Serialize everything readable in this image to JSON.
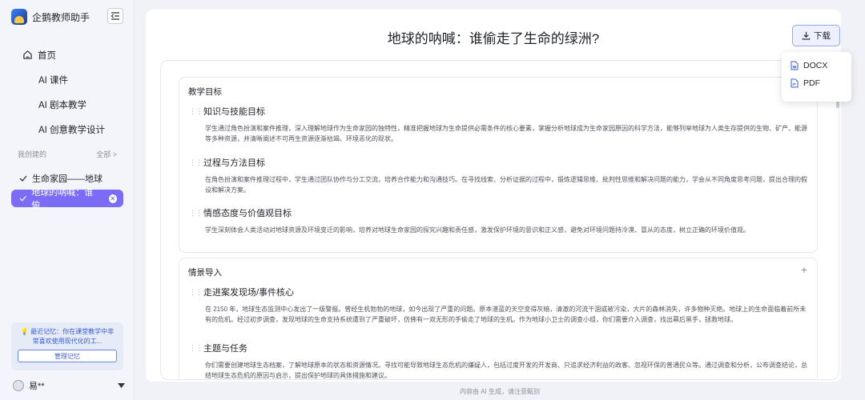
{
  "sidebar": {
    "brand": "企鹅教师助手",
    "nav": [
      {
        "label": "首页"
      },
      {
        "label": "AI 课件"
      },
      {
        "label": "AI 剧本教学"
      },
      {
        "label": "AI 创意教学设计"
      }
    ],
    "section_label": "我创建的",
    "section_all": "全部 >",
    "history": [
      {
        "label": "生命家园——地球"
      },
      {
        "label": "地球的呐喊：谁偷..."
      }
    ],
    "memory_text": "最近记忆：你在课堂教学中非常喜欢使用现代化的工...",
    "memory_button": "管理记忆",
    "user_name": "易**"
  },
  "main": {
    "title": "地球的呐喊：谁偷走了生命的绿洲?",
    "download_label": "下载",
    "download_options": [
      "DOCX",
      "PDF"
    ],
    "sections": [
      {
        "title": "教学目标",
        "items": [
          {
            "heading": "知识与技能目标",
            "body": "学生通过角色扮演和案件推理，深入理解地球作为生命家园的独特性，精准把握地球为生命提供必需条件的核心要素，掌握分析地球成为生命家园原因的科学方法，能够列举地球为人类生存提供的生物、矿产、能源等多种资源，并清晰阐述不可再生资源逐渐枯竭、环境恶化的现状。"
          },
          {
            "heading": "过程与方法目标",
            "body": "在角色扮演和案件推理过程中，学生通过团队协作与分工交流，培养合作能力和沟通技巧。在寻找线索、分析证据的过程中，锻炼逻辑思维、批判性思维和解决问题的能力，学会从不同角度思考问题，提出合理的假设和解决方案。"
          },
          {
            "heading": "情感态度与价值观目标",
            "body": "学生深刻体会人类活动对地球资源及环境变迁的影响，培养对地球生命家园的探究兴趣和责任感，激发保护环境的意识和正义感，避免对环境问题持冷漠、冒从的态度，树立正确的环境价值观。"
          }
        ]
      },
      {
        "title": "情景导入",
        "items": [
          {
            "heading": "走进案发现场/事件核心",
            "body": "在 2150 年，地球生态监测中心发出了一级警报。曾经生机勃勃的地球，如今出现了严重的问题。原本湛蓝的天空变得灰暗，清澈的河流干涸或被污染，大片的森林消失，许多物种灭绝。地球上的生命面临着前所未有的危机。经过初步调查，发现地球的生命支持系统遭到了严重破坏，仿佛有一双无形的手偷走了地球的生机。作为地球小卫士的调查小组，你们需要介入调查，找出幕后黑手，拯救地球。"
          },
          {
            "heading": "主题与任务",
            "body": "你们需要创建地球生态档案，了解地球原本的状态和资源情况。寻找可能导致地球生态危机的嫌疑人，包括过度开发的开发商、只追求经济利益的政客、忽视环保的普通民众等。通过调查和分析，公布调查结论，总结地球生态危机的原因与启示，提出保护地球的具体措施和建议。"
          }
        ]
      }
    ]
  },
  "footer": "内容由 AI 生成，请注意甄别"
}
